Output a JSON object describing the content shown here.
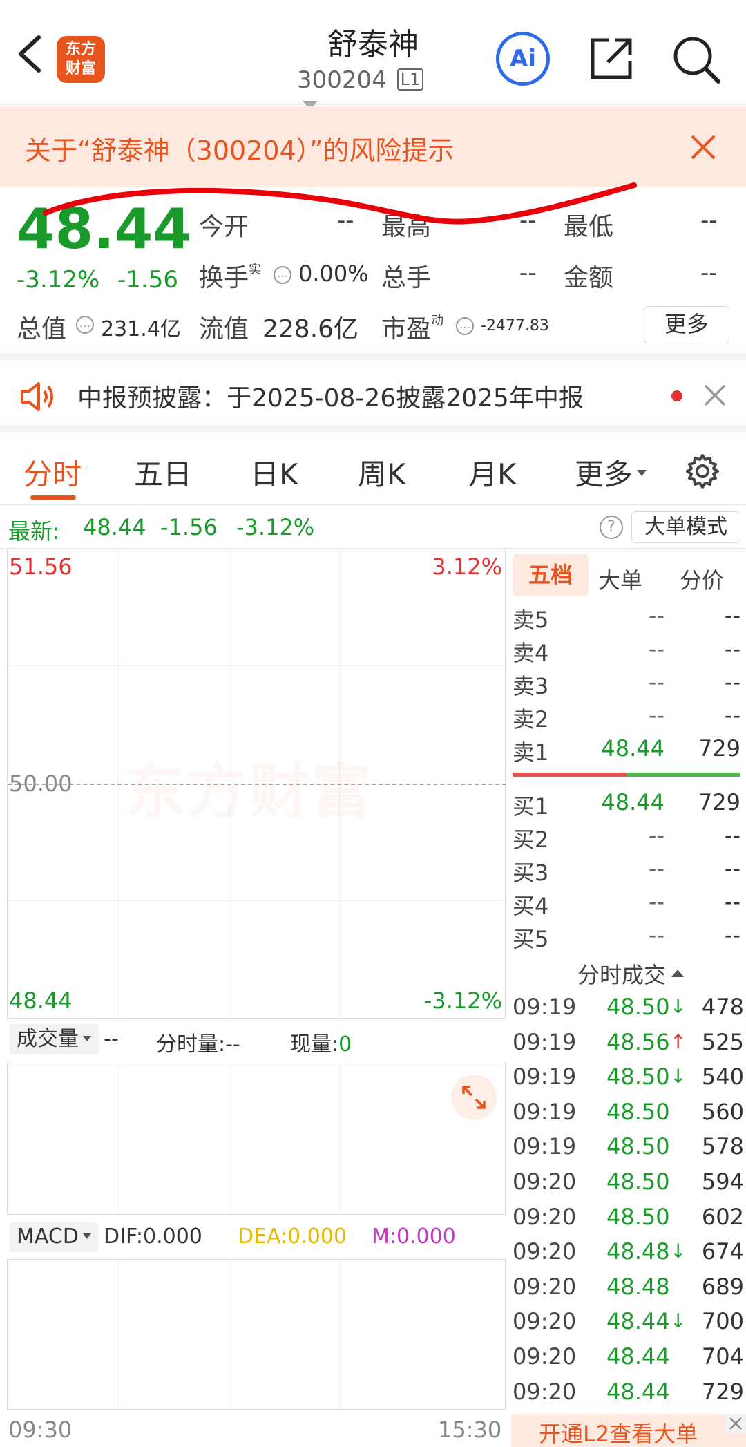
{
  "header": {
    "stock_name": "舒泰神",
    "stock_code": "300204",
    "level_badge": "L1",
    "logo_line1": "东方",
    "logo_line2": "财富",
    "ai_label": "Ai"
  },
  "banner": {
    "text": "关于“舒泰神（300204）”的风险提示"
  },
  "quote": {
    "price": "48.44",
    "change_pct": "-3.12%",
    "change": "-1.56",
    "open_label": "今开",
    "open_value": "--",
    "high_label": "最高",
    "high_value": "--",
    "low_label": "最低",
    "low_value": "--",
    "turnover_label": "换手",
    "turnover_sup": "实",
    "turnover_value": "0.00%",
    "volume_label": "总手",
    "volume_value": "--",
    "amount_label": "金额",
    "amount_value": "--",
    "mktcap_label": "总值",
    "mktcap_value": "231.4亿",
    "float_label": "流值",
    "float_value": "228.6亿",
    "pe_label": "市盈",
    "pe_sup": "动",
    "pe_value": "-2477.83",
    "more_button": "更多"
  },
  "notice": {
    "text": "中报预披露：于2025-08-26披露2025年中报"
  },
  "tabs": [
    "分时",
    "五日",
    "日K",
    "周K",
    "月K",
    "更多"
  ],
  "latest_bar": {
    "label": "最新:",
    "price": "48.44",
    "change": "-1.56",
    "pct": "-3.12%",
    "mode_button": "大单模式"
  },
  "chart": {
    "top_price": "51.56",
    "top_pct": "3.12%",
    "mid_price": "50.00",
    "bottom_price": "48.44",
    "bottom_pct": "-3.12%",
    "watermark": "东方财富",
    "time_start": "09:30",
    "time_end": "15:30"
  },
  "volume": {
    "selector": "成交量",
    "value": "--",
    "fenshi_label": "分时量:--",
    "xianliang_label": "现量:",
    "xianliang_value": "0"
  },
  "macd": {
    "selector": "MACD",
    "dif": "DIF:0.000",
    "dea": "DEA:0.000",
    "m": "M:0.000"
  },
  "orderbook": {
    "tabs": [
      "五档",
      "大单",
      "分价"
    ],
    "asks": [
      {
        "label": "卖5",
        "price": "--",
        "vol": "--"
      },
      {
        "label": "卖4",
        "price": "--",
        "vol": "--"
      },
      {
        "label": "卖3",
        "price": "--",
        "vol": "--"
      },
      {
        "label": "卖2",
        "price": "--",
        "vol": "--"
      },
      {
        "label": "卖1",
        "price": "48.44",
        "vol": "729"
      }
    ],
    "bids": [
      {
        "label": "买1",
        "price": "48.44",
        "vol": "729"
      },
      {
        "label": "买2",
        "price": "--",
        "vol": "--"
      },
      {
        "label": "买3",
        "price": "--",
        "vol": "--"
      },
      {
        "label": "买4",
        "price": "--",
        "vol": "--"
      },
      {
        "label": "买5",
        "price": "--",
        "vol": "--"
      }
    ]
  },
  "trades": {
    "title": "分时成交",
    "rows": [
      {
        "time": "09:19",
        "price": "48.50",
        "arrow": "↓",
        "vol": "478"
      },
      {
        "time": "09:19",
        "price": "48.56",
        "arrow": "↑",
        "vol": "525"
      },
      {
        "time": "09:19",
        "price": "48.50",
        "arrow": "↓",
        "vol": "540"
      },
      {
        "time": "09:19",
        "price": "48.50",
        "arrow": "",
        "vol": "560"
      },
      {
        "time": "09:19",
        "price": "48.50",
        "arrow": "",
        "vol": "578"
      },
      {
        "time": "09:20",
        "price": "48.50",
        "arrow": "",
        "vol": "594"
      },
      {
        "time": "09:20",
        "price": "48.50",
        "arrow": "",
        "vol": "602"
      },
      {
        "time": "09:20",
        "price": "48.48",
        "arrow": "↓",
        "vol": "674"
      },
      {
        "time": "09:20",
        "price": "48.48",
        "arrow": "",
        "vol": "689"
      },
      {
        "time": "09:20",
        "price": "48.44",
        "arrow": "↓",
        "vol": "700"
      },
      {
        "time": "09:20",
        "price": "48.44",
        "arrow": "",
        "vol": "704"
      },
      {
        "time": "09:20",
        "price": "48.44",
        "arrow": "",
        "vol": "729"
      }
    ],
    "l2_button": "开通L2查看大单"
  },
  "colors": {
    "brand_orange": "#e8541e",
    "down_green": "#1a9a2a",
    "up_red": "#e33030",
    "banner_bg": "#fde9df",
    "annotation_red": "#e8000b"
  }
}
